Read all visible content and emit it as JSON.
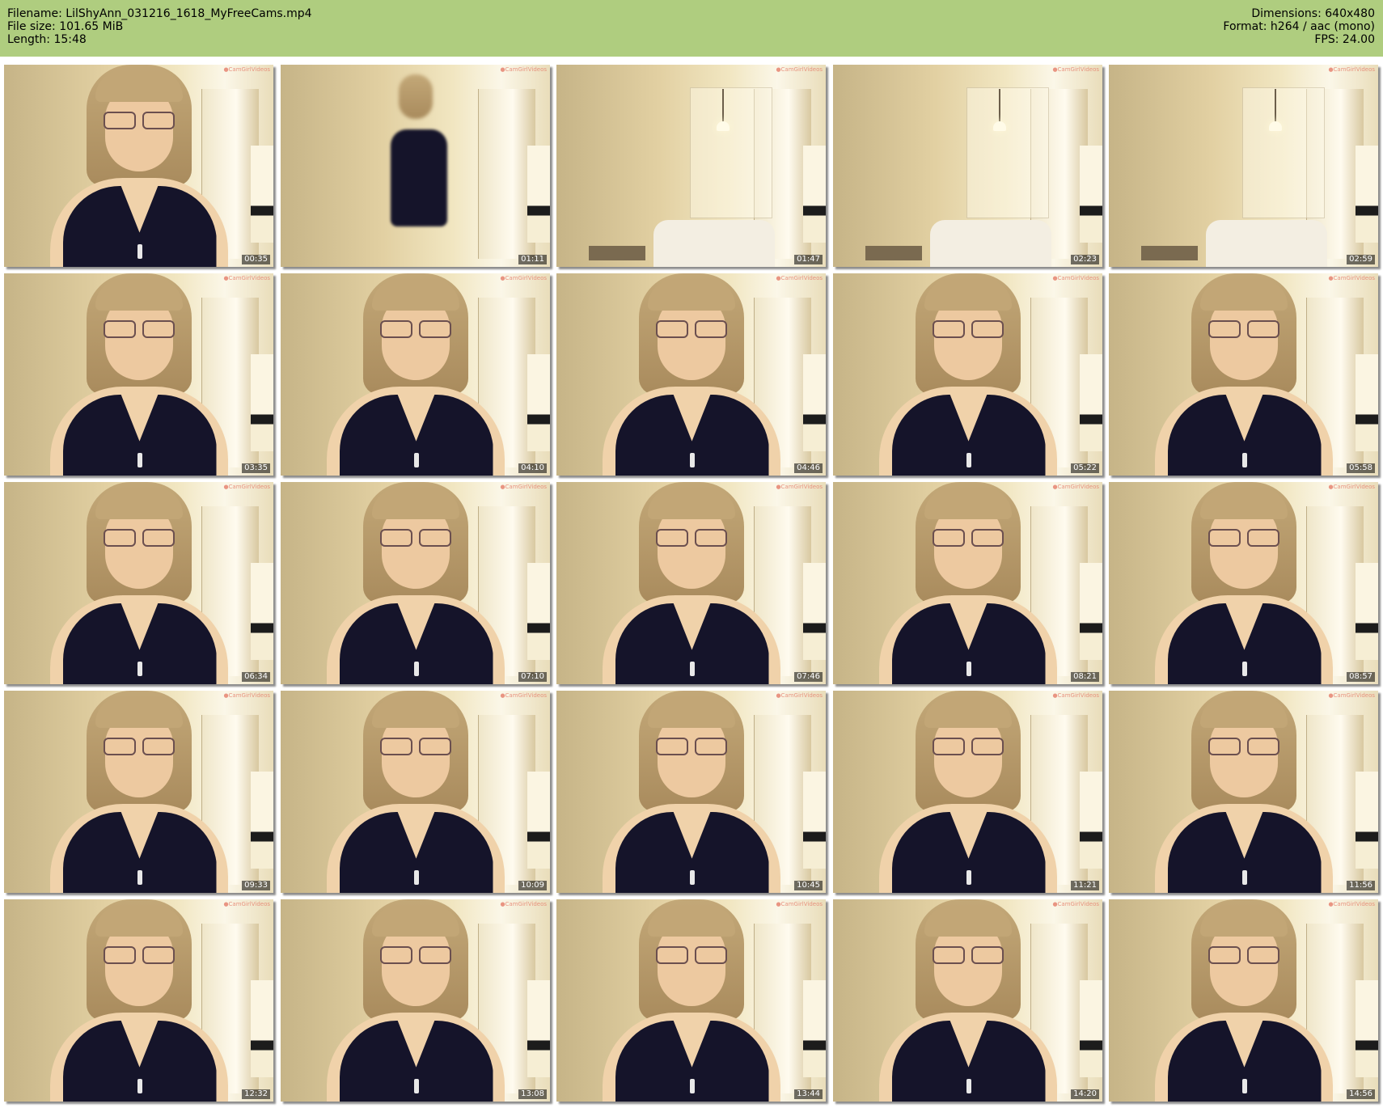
{
  "header": {
    "filename_line": "Filename: LilShyAnn_031216_1618_MyFreeCams.mp4",
    "filesize_line": "File size: 101.65 MiB",
    "length_line": "Length: 15:48",
    "dimensions_line": "Dimensions: 640x480",
    "format_line": "Format: h264 / aac (mono)",
    "fps_line": "FPS: 24.00"
  },
  "colors": {
    "header_bg": "#afcd7f",
    "watermark": "#e57d6a"
  },
  "thumbnails": [
    {
      "time": "00:35",
      "scene": "person"
    },
    {
      "time": "01:11",
      "scene": "standing"
    },
    {
      "time": "01:47",
      "scene": "room"
    },
    {
      "time": "02:23",
      "scene": "room"
    },
    {
      "time": "02:59",
      "scene": "room"
    },
    {
      "time": "03:35",
      "scene": "person"
    },
    {
      "time": "04:10",
      "scene": "person"
    },
    {
      "time": "04:46",
      "scene": "person"
    },
    {
      "time": "05:22",
      "scene": "person"
    },
    {
      "time": "05:58",
      "scene": "person"
    },
    {
      "time": "06:34",
      "scene": "person"
    },
    {
      "time": "07:10",
      "scene": "person"
    },
    {
      "time": "07:46",
      "scene": "person"
    },
    {
      "time": "08:21",
      "scene": "person"
    },
    {
      "time": "08:57",
      "scene": "person"
    },
    {
      "time": "09:33",
      "scene": "person"
    },
    {
      "time": "10:09",
      "scene": "person"
    },
    {
      "time": "10:45",
      "scene": "person"
    },
    {
      "time": "11:21",
      "scene": "person"
    },
    {
      "time": "11:56",
      "scene": "person"
    },
    {
      "time": "12:32",
      "scene": "person"
    },
    {
      "time": "13:08",
      "scene": "person"
    },
    {
      "time": "13:44",
      "scene": "person"
    },
    {
      "time": "14:20",
      "scene": "person"
    },
    {
      "time": "14:56",
      "scene": "person"
    }
  ]
}
